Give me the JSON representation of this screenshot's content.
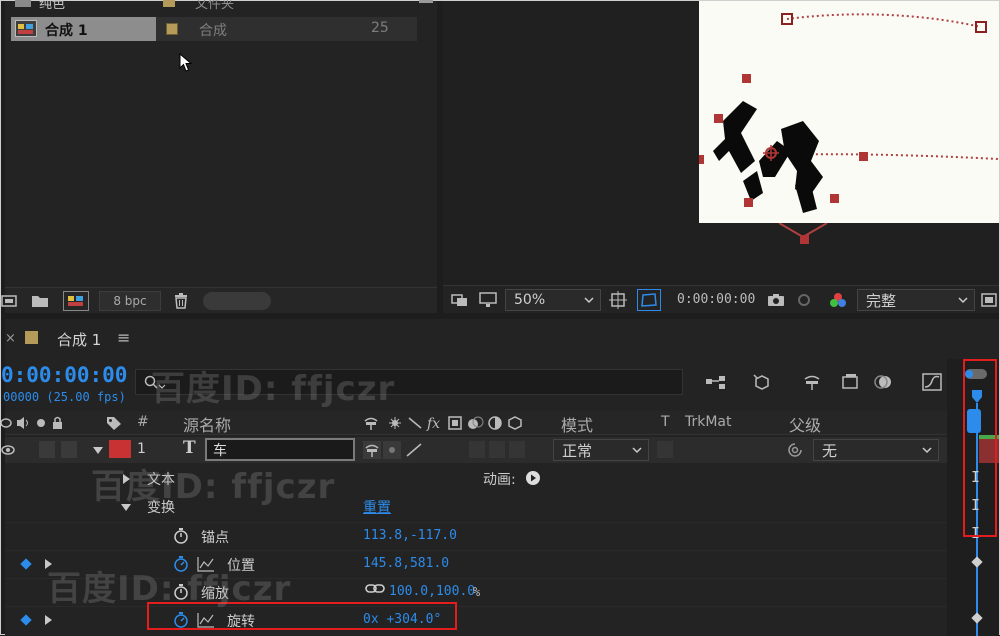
{
  "project": {
    "rows": [
      {
        "name": "纯色",
        "type": "文件夹",
        "size": ""
      },
      {
        "name": "合成 1",
        "type": "合成",
        "size": "25"
      }
    ],
    "bpc": "8 bpc"
  },
  "viewer": {
    "zoom": "50%",
    "timecode": "0:00:00:00",
    "quality": "完整"
  },
  "timeline": {
    "tab_label": "合成 1",
    "menu_glyph": "≡",
    "current_time": "0:00:00:00",
    "fps_line": "00000 (25.00 fps)",
    "search_placeholder": "",
    "headers": {
      "hash": "#",
      "source_name": "源名称",
      "mode": "模式",
      "t": "T",
      "trkmat": "TrkMat",
      "parent": "父级"
    },
    "layer": {
      "index": "1",
      "type_glyph": "T",
      "name": "车",
      "mode": "正常",
      "parent": "无"
    },
    "groups": {
      "text": "文本",
      "animate": "动画:",
      "transform": "变换",
      "reset": "重置"
    },
    "props": [
      {
        "name": "锚点",
        "value": "113.8,-117.0"
      },
      {
        "name": "位置",
        "value": "145.8,581.0"
      },
      {
        "name": "缩放",
        "value": "100.0,100.0",
        "unit": "%"
      },
      {
        "name": "旋转",
        "value": "0x +304.0°"
      }
    ]
  },
  "watermark": "百度ID: ffjczr",
  "colors": {
    "accent": "#2d8ceb",
    "label_red": "#c83232",
    "highlight": "#e21d1d",
    "motion_path": "#c0392b"
  }
}
